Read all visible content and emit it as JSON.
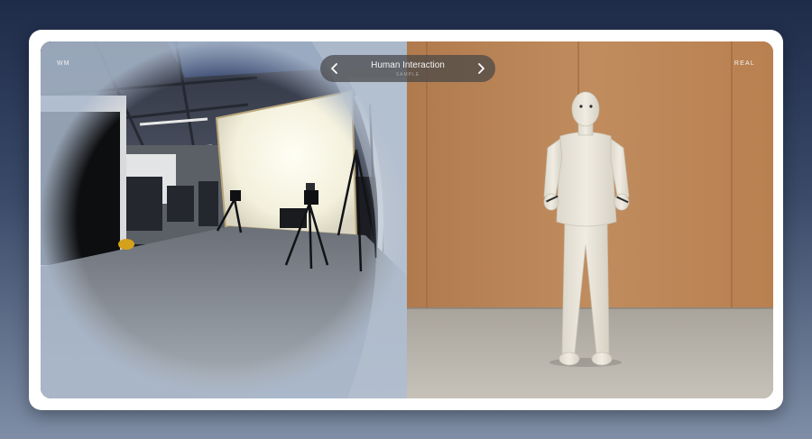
{
  "left_panel": {
    "label": "WM"
  },
  "right_panel": {
    "label": "REAL"
  },
  "selector": {
    "title": "Human Interaction",
    "subtitle": "SAMPLE",
    "prev_icon": "chevron-left-icon",
    "next_icon": "chevron-right-icon"
  },
  "colors": {
    "background_top": "#1e2b49",
    "background_bottom": "#7f8ea6",
    "card": "#ffffff",
    "wood_wall": "#b98558",
    "floor": "#bcb8b1"
  }
}
